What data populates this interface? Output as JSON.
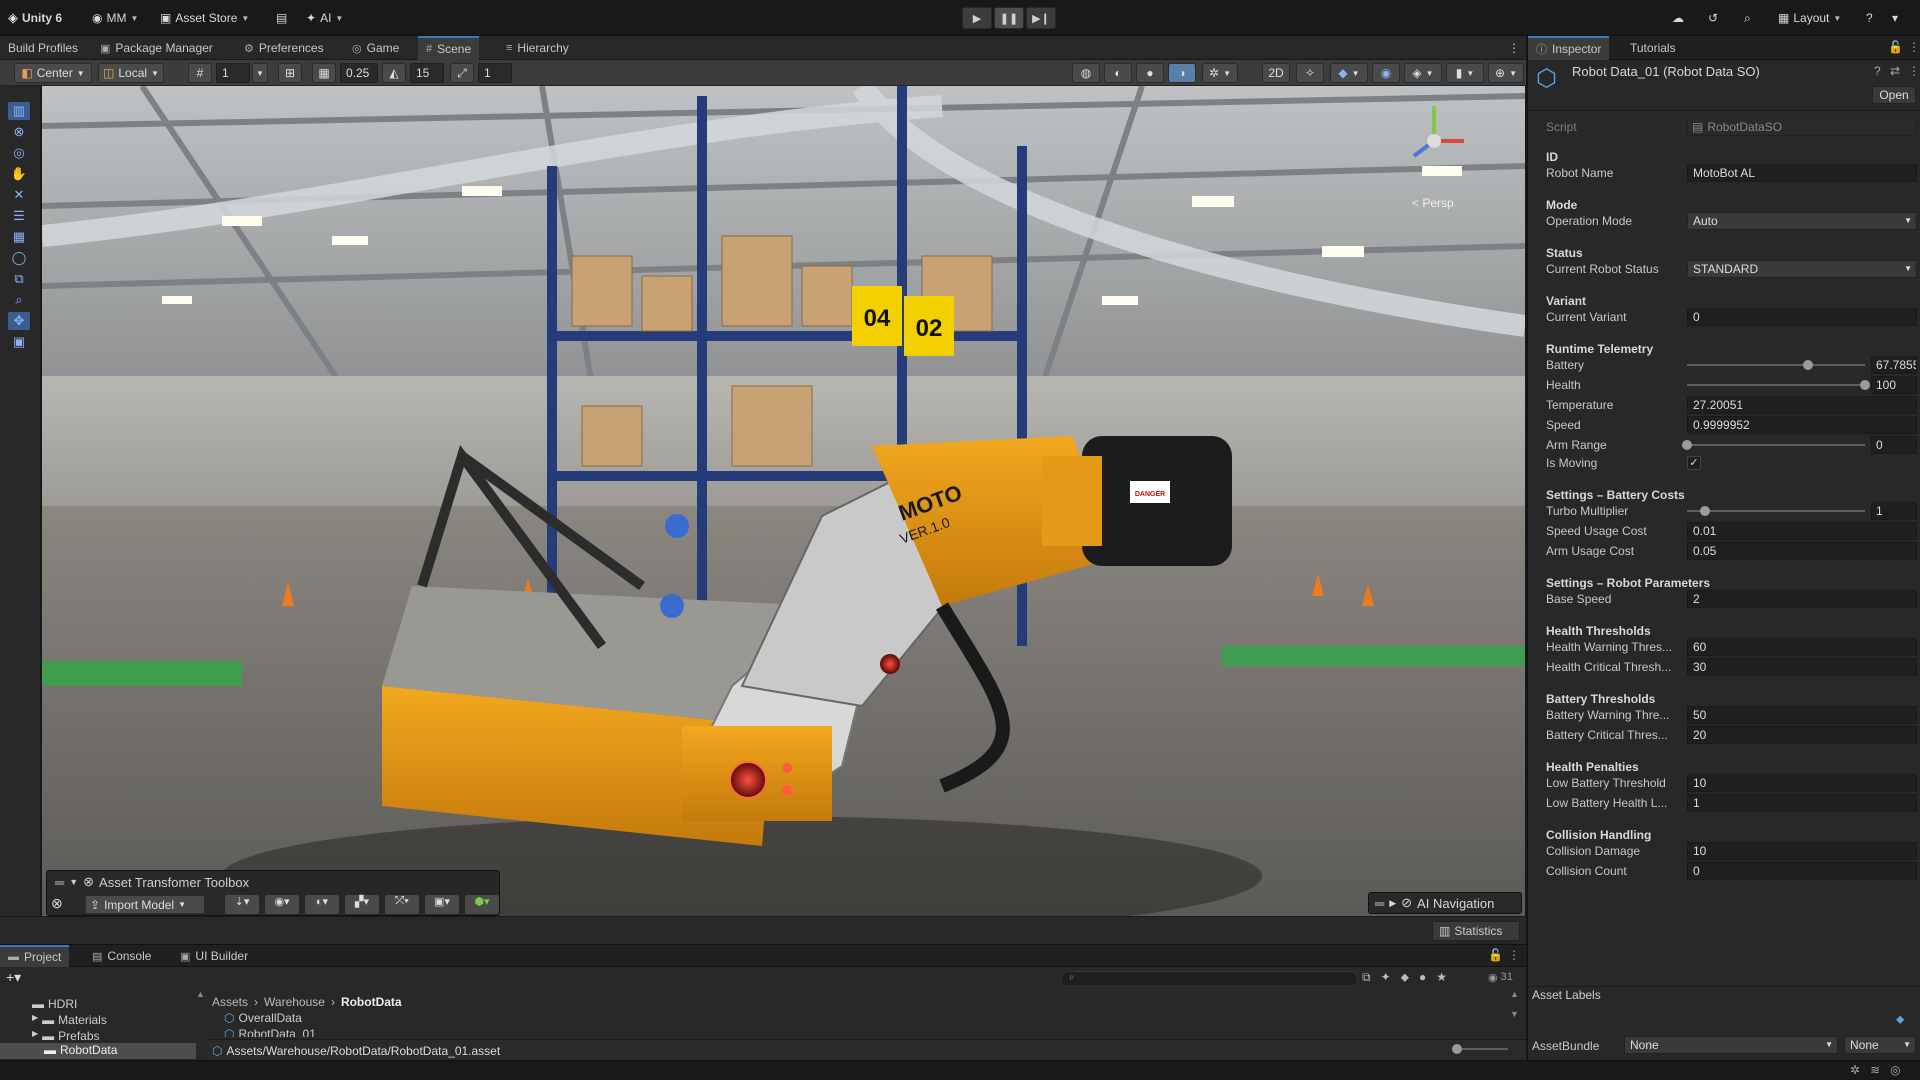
{
  "app": {
    "title": "Unity 6"
  },
  "topbar": {
    "account": "MM",
    "asset_store": "Asset Store",
    "ai": "AI",
    "layout": "Layout"
  },
  "tabs": [
    {
      "label": "Build Profiles"
    },
    {
      "label": "Package Manager"
    },
    {
      "label": "Preferences"
    },
    {
      "label": "Game"
    },
    {
      "label": "Scene"
    },
    {
      "label": "Hierarchy"
    }
  ],
  "scene_toolbar": {
    "pivot": "Center",
    "space": "Local",
    "grid_size": "1",
    "snap_increment": "0.25",
    "rotate_snap": "15",
    "scale_snap": "1"
  },
  "scene": {
    "view_label": "< Persp",
    "rack_labels": [
      "04",
      "02"
    ],
    "robot_brand": "MOTO",
    "robot_version": "VER.1.0",
    "danger_label": "DANGER",
    "overlay_asset_transformer": "Asset Transfomer Toolbox",
    "overlay_import_model": "Import Model",
    "overlay_ai_navigation": "AI Navigation",
    "statistics": "Statistics"
  },
  "inspector": {
    "tab_inspector": "Inspector",
    "tab_tutorials": "Tutorials",
    "object_title": "Robot Data_01 (Robot Data SO)",
    "open_button": "Open",
    "script_label": "Script",
    "script_value": "RobotDataSO",
    "sections": {
      "id": "ID",
      "mode": "Mode",
      "status": "Status",
      "variant": "Variant",
      "telemetry": "Runtime Telemetry",
      "battery_costs": "Settings – Battery Costs",
      "robot_params": "Settings – Robot Parameters",
      "health_thresholds": "Health Thresholds",
      "battery_thresholds": "Battery Thresholds",
      "health_penalties": "Health Penalties",
      "collision": "Collision Handling"
    },
    "fields": {
      "robot_name_label": "Robot Name",
      "robot_name": "MotoBot AL",
      "operation_mode_label": "Operation Mode",
      "operation_mode": "Auto",
      "robot_status_label": "Current Robot Status",
      "robot_status": "STANDARD",
      "current_variant_label": "Current Variant",
      "current_variant": "0",
      "battery_label": "Battery",
      "battery": "67.7855",
      "health_label": "Health",
      "health": "100",
      "temperature_label": "Temperature",
      "temperature": "27.20051",
      "speed_label": "Speed",
      "speed": "0.9999952",
      "arm_range_label": "Arm Range",
      "arm_range": "0",
      "is_moving_label": "Is Moving",
      "turbo_label": "Turbo Multiplier",
      "turbo": "1",
      "speed_cost_label": "Speed Usage Cost",
      "speed_cost": "0.01",
      "arm_cost_label": "Arm Usage Cost",
      "arm_cost": "0.05",
      "base_speed_label": "Base Speed",
      "base_speed": "2",
      "health_warn_label": "Health Warning Thres...",
      "health_warn": "60",
      "health_crit_label": "Health Critical Thresh...",
      "health_crit": "30",
      "battery_warn_label": "Battery Warning Thre...",
      "battery_warn": "50",
      "battery_crit_label": "Battery Critical Thres...",
      "battery_crit": "20",
      "low_batt_thresh_label": "Low Battery Threshold",
      "low_batt_thresh": "10",
      "low_batt_health_label": "Low Battery Health L...",
      "low_batt_health": "1",
      "collision_damage_label": "Collision Damage",
      "collision_damage": "10",
      "collision_count_label": "Collision Count",
      "collision_count": "0"
    },
    "slider_levels": {
      "battery": 0.678,
      "health": 1.0,
      "arm_range": 0.0,
      "turbo": 0.1
    },
    "asset_labels": "Asset Labels",
    "asset_bundle_label": "AssetBundle",
    "asset_bundle_value": "None",
    "asset_bundle_variant": "None"
  },
  "bottom": {
    "tab_project": "Project",
    "tab_console": "Console",
    "tab_ui_builder": "UI Builder",
    "folders": [
      "HDRI",
      "Materials",
      "Prefabs",
      "RobotData"
    ],
    "breadcrumb": [
      "Assets",
      "Warehouse",
      "RobotData"
    ],
    "files": [
      "OverallData",
      "RobotData_01"
    ],
    "selected_path": "Assets/Warehouse/RobotData/RobotData_01.asset",
    "hidden_count": "31"
  }
}
